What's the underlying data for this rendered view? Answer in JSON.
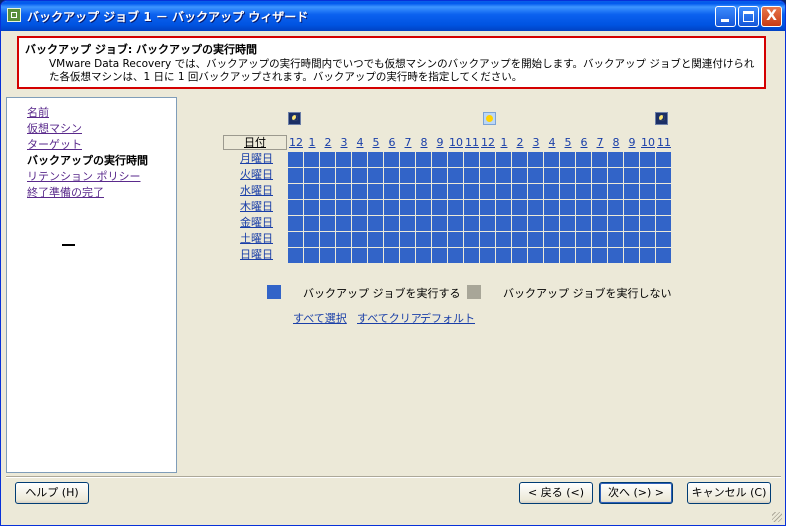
{
  "window": {
    "title": "バックアップ ジョブ 1 － バックアップ ウィザード",
    "controls": {
      "minimize": "_",
      "maximize": "□",
      "close": "X"
    }
  },
  "header": {
    "title": "バックアップ ジョブ: バックアップの実行時間",
    "description": "VMware Data Recovery では、バックアップの実行時間内でいつでも仮想マシンのバックアップを開始します。バックアップ ジョブと関連付けられた各仮想マシンは、1 日に 1 回バックアップされます。バックアップの実行時を指定してください。"
  },
  "nav": {
    "items": [
      {
        "label": "名前",
        "current": false
      },
      {
        "label": "仮想マシン",
        "current": false
      },
      {
        "label": "ターゲット",
        "current": false
      },
      {
        "label": "バックアップの実行時間",
        "current": true
      },
      {
        "label": "リテンション ポリシー",
        "current": false
      },
      {
        "label": "終了準備の完了",
        "current": false
      }
    ]
  },
  "schedule": {
    "date_header": "日付",
    "hours": [
      "12",
      "1",
      "2",
      "3",
      "4",
      "5",
      "6",
      "7",
      "8",
      "9",
      "10",
      "11",
      "12",
      "1",
      "2",
      "3",
      "4",
      "5",
      "6",
      "7",
      "8",
      "9",
      "10",
      "11"
    ],
    "days": [
      "月曜日",
      "火曜日",
      "水曜日",
      "木曜日",
      "金曜日",
      "土曜日",
      "日曜日"
    ],
    "time_icons": [
      "moon-icon",
      "sun-icon",
      "moon-icon"
    ],
    "all_cells_enabled": true,
    "colors": {
      "run": "#3264c8",
      "no_run": "#a8a698"
    }
  },
  "legend": {
    "run_label": "バックアップ ジョブを実行する",
    "no_run_label": "バックアップ ジョブを実行しない"
  },
  "links": {
    "select_all": "すべて選択",
    "clear_all": "すべてクリア",
    "default": "デフォルト"
  },
  "buttons": {
    "help": "ヘルプ (H)",
    "back": "< 戻る (<)",
    "next": "次へ (>) >",
    "cancel": "キャンセル (C)"
  }
}
